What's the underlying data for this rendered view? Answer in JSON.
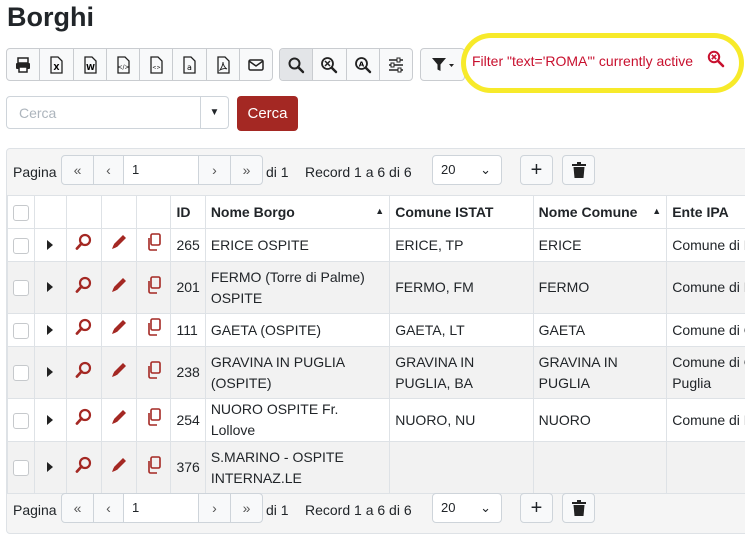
{
  "page": {
    "title": "Borghi"
  },
  "toolbar": {
    "export_icons": [
      "printer-icon",
      "excel-icon",
      "word-icon",
      "xml-icon",
      "html-icon",
      "text-icon",
      "pdf-icon",
      "email-icon"
    ],
    "search_icons": [
      "search-icon",
      "zoom-filter-icon",
      "zoom-text-icon",
      "settings-sliders-icon"
    ],
    "filter_icon": "filter-dropdown-icon"
  },
  "filter_notice": {
    "text": "Filter \"text='ROMA'\" currently active",
    "icon": "search-remove-icon",
    "highlight_color": "#f7ea2a"
  },
  "search": {
    "placeholder": "Cerca",
    "button_label": "Cerca"
  },
  "pager": {
    "label": "Pagina",
    "page": "1",
    "of_text": "di 1",
    "record_text": "Record 1 a 6 di 6",
    "page_size": "20"
  },
  "table": {
    "headers": [
      "ID",
      "Nome Borgo",
      "Comune ISTAT",
      "Nome Comune",
      "Ente IPA"
    ],
    "rows": [
      {
        "id": "265",
        "nome": "ERICE OSPITE",
        "istat": "ERICE, TP",
        "comune": "ERICE",
        "ente": "Comune di E"
      },
      {
        "id": "201",
        "nome": "FERMO (Torre di Palme) OSPITE",
        "istat": "FERMO, FM",
        "comune": "FERMO",
        "ente": "Comune di F"
      },
      {
        "id": "111",
        "nome": "GAETA (OSPITE)",
        "istat": "GAETA, LT",
        "comune": "GAETA",
        "ente": "Comune di G"
      },
      {
        "id": "238",
        "nome": "GRAVINA IN PUGLIA (OSPITE)",
        "istat": "GRAVINA IN PUGLIA, BA",
        "comune": "GRAVINA IN PUGLIA",
        "ente": "Comune di G Puglia"
      },
      {
        "id": "254",
        "nome": "NUORO OSPITE Fr. Lollove",
        "istat": "NUORO, NU",
        "comune": "NUORO",
        "ente": "Comune di N"
      },
      {
        "id": "376",
        "nome": "S.MARINO - OSPITE INTERNAZ.LE",
        "istat": "",
        "comune": "",
        "ente": ""
      }
    ]
  },
  "colors": {
    "accent": "#a42823",
    "danger_text": "#c8102e"
  }
}
